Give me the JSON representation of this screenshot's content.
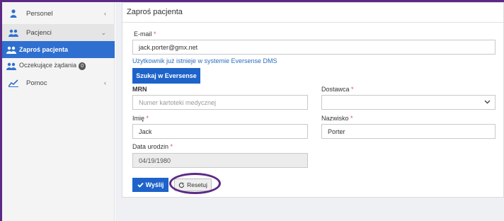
{
  "sidebar": {
    "items": [
      {
        "label": "Personel",
        "icon": "person-icon",
        "chevron": "‹"
      },
      {
        "label": "Pacjenci",
        "icon": "patients-icon",
        "chevron": "⌄"
      },
      {
        "label": "Zaproś pacjenta",
        "icon": "patients-icon"
      },
      {
        "label": "Oczekujące żądania",
        "icon": "patients-icon",
        "badge": "0"
      },
      {
        "label": "Pomoc",
        "icon": "chart-icon",
        "chevron": "‹"
      }
    ]
  },
  "panel": {
    "title": "Zaproś pacjenta"
  },
  "form": {
    "email_label": "E-mail",
    "email_value": "jack.porter@gmx.net",
    "email_note": "Użytkownik już istnieje w systemie Eversense DMS",
    "search_button": "Szukaj w Eversense",
    "mrn_label": "MRN",
    "mrn_placeholder": "Numer kartoteki medycznej",
    "provider_label": "Dostawca",
    "provider_value": "",
    "first_name_label": "Imię",
    "first_name_value": "Jack",
    "last_name_label": "Nazwisko",
    "last_name_value": "Porter",
    "dob_label": "Data urodzin",
    "dob_value": "04/19/1980",
    "required_mark": "*"
  },
  "actions": {
    "send_label": "Wyślij",
    "reset_label": "Resetuj"
  },
  "colors": {
    "accent": "#1e63c9",
    "highlight_ring": "#5b2a86",
    "required": "#d9534f"
  }
}
